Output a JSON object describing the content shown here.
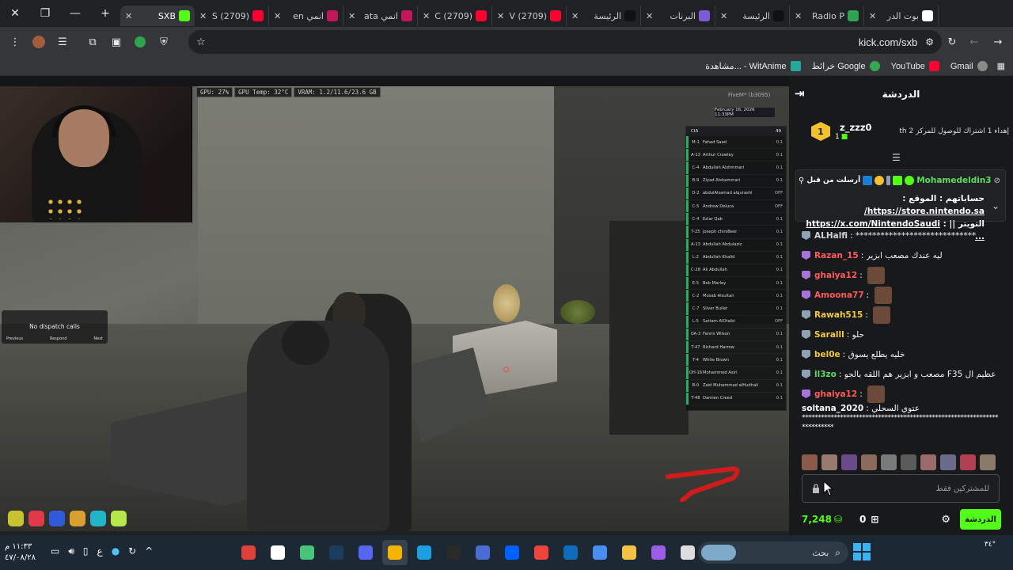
{
  "browser": {
    "window_controls": {
      "close": "✕",
      "restore": "❐",
      "minimize": "—"
    },
    "new_tab": "+",
    "tabs": [
      {
        "title": "بوت الدر",
        "color": "#ffffff",
        "active": false
      },
      {
        "title": "Radio P",
        "color": "#2ea44f",
        "active": false
      },
      {
        "title": "الرئيسة",
        "color": "#111111",
        "active": false
      },
      {
        "title": "البرنات",
        "color": "#7b5cd6",
        "active": false
      },
      {
        "title": "الرئيسة",
        "color": "#111111",
        "active": false
      },
      {
        "title": "(2709) V",
        "color": "#ff0033",
        "active": false
      },
      {
        "title": "(2709) C",
        "color": "#ff0033",
        "active": false
      },
      {
        "title": "انمي ata",
        "color": "#c2185b",
        "active": false
      },
      {
        "title": "انمي en",
        "color": "#c2185b",
        "active": false
      },
      {
        "title": "(2709) S",
        "color": "#ff0033",
        "active": false
      },
      {
        "title": "SXB",
        "color": "#53fc18",
        "active": true
      }
    ],
    "url": "kick.com/sxb",
    "bookmarks": [
      {
        "label": "Gmail",
        "color": "#ea4335"
      },
      {
        "label": "YouTube",
        "color": "#ff0033"
      },
      {
        "label": "خرائط Google",
        "color": "#34a853"
      },
      {
        "label": "مشاهدة... - WitAnime",
        "color": "#26a69a"
      }
    ]
  },
  "stream": {
    "gpu": [
      "GPU: 27%",
      "GPU Temp: 32°C",
      "VRAM: 1.2/11.6/23.6 GB"
    ],
    "watermark": "FiveM* (b3095)",
    "date": "February 16, 2026 11:33PM",
    "roster": {
      "title": "CIA",
      "count": "49",
      "members": [
        {
          "code": "M-1",
          "name": "Fahad Saad",
          "status": "0.1"
        },
        {
          "code": "A-13",
          "name": "Arthur Crowley",
          "status": "0.1"
        },
        {
          "code": "C-4",
          "name": "Abdullah Alshmmari",
          "status": "0.1"
        },
        {
          "code": "B-9",
          "name": "Ziyad Alshammari",
          "status": "0.1"
        },
        {
          "code": "D-2",
          "name": "abdulAlsamad alqurashi",
          "status": "OFF"
        },
        {
          "code": "C-5",
          "name": "Andrew Deluca",
          "status": "OFF"
        },
        {
          "code": "C-4",
          "name": "Ezlar Qab",
          "status": "0.1"
        },
        {
          "code": "T-25",
          "name": "Joseph chirsBeer",
          "status": "0.1"
        },
        {
          "code": "A-13",
          "name": "Abdullah Abdulaziz",
          "status": "0.1"
        },
        {
          "code": "L-2",
          "name": "Abdullah Khalid",
          "status": "0.1"
        },
        {
          "code": "C-28",
          "name": "Ali Abdullah",
          "status": "0.1"
        },
        {
          "code": "E-5",
          "name": "Bob Marley",
          "status": "0.1"
        },
        {
          "code": "C-2",
          "name": "Musab Alsultan",
          "status": "0.1"
        },
        {
          "code": "C-7",
          "name": "Silver Bullet",
          "status": "0.1"
        },
        {
          "code": "L-5",
          "name": "Sattam AlOtaibi",
          "status": "OFF"
        },
        {
          "code": "OA-3",
          "name": "Fenris Wilson",
          "status": "0.1"
        },
        {
          "code": "T-47",
          "name": "Richard Harrow",
          "status": "0.1"
        },
        {
          "code": "T-4",
          "name": "White Brown",
          "status": "0.1"
        },
        {
          "code": "OH-16",
          "name": "Mohammed Asiri",
          "status": "0.1"
        },
        {
          "code": "B-0",
          "name": "Zaid Muhammad alHudhali",
          "status": "0.1"
        },
        {
          "code": "T-48",
          "name": "Damien Creed",
          "status": "0.1"
        }
      ]
    },
    "dispatch": {
      "title": "No dispatch calls",
      "prev": "Previous",
      "respond": "Respond",
      "next": "Next"
    },
    "hud_colors": [
      "#c9c230",
      "#e03a4a",
      "#2f5bd8",
      "#d8a030",
      "#22b5c9",
      "#b6e84a"
    ]
  },
  "chat": {
    "title": "الدردشة",
    "gift": {
      "user": "z_zzz0",
      "badge": "1",
      "count": "1",
      "text": "إهداء 1 اشتراك للوصول للمركز 2 th"
    },
    "pinned": {
      "user": "Mohamedeldin3",
      "sent": "أرسلت من قبل",
      "line1_prefix": "حساباتهم : الموقع : ",
      "line1_link": "https://store.nintendo.sa/",
      "line2_prefix": "التويتر || : ",
      "line2_link": "https://x.com/NintendoSaudi ..."
    },
    "messages": [
      {
        "user": "ALHalfi",
        "color": "#d3d3d3",
        "badge": "gray",
        "text": "*****************************",
        "emote": false
      },
      {
        "user": "Razan_15",
        "color": "#ff5b5b",
        "badge": "purple",
        "text": "ليه عندك مصعب ابزير",
        "emote": false
      },
      {
        "user": "ghaiya12",
        "color": "#ff5b5b",
        "badge": "purple",
        "text": "",
        "emote": true
      },
      {
        "user": "Amoona77",
        "color": "#ff5b5b",
        "badge": "purple",
        "text": "",
        "emote": true
      },
      {
        "user": "Rawah515",
        "color": "#f1c93b",
        "badge": "gray",
        "text": "",
        "emote": true
      },
      {
        "user": "Saralll",
        "color": "#f1c93b",
        "badge": "gray",
        "text": "حلو",
        "emote": false
      },
      {
        "user": "bel0e",
        "color": "#f1c93b",
        "badge": "gray",
        "text": "خليه يطلع يسوق",
        "emote": false
      },
      {
        "user": "ll3zo",
        "color": "#5ddc5f",
        "badge": "gray",
        "text": "مصعب و ابزير هم اللقه بالجو F35 عظيم ال",
        "emote": false
      },
      {
        "user": "ghaiya12",
        "color": "#ff5b5b",
        "badge": "purple",
        "text": "",
        "emote": true
      }
    ],
    "last_message": {
      "user": "soltana_2020",
      "text": "عتوي السحلي",
      "stars": "************************************************************************"
    },
    "input_placeholder": "للمشتركين فقط",
    "viewers": "7,248",
    "points": "0",
    "chat_button": "الدردشة"
  },
  "taskbar": {
    "time": "١١:٣٣ م",
    "date": "٤٧/٠٨/٢٨",
    "language": "ع",
    "search_placeholder": "بحث",
    "weather": "٣٤°",
    "apps": [
      {
        "name": "adobe-acrobat",
        "color": "#e0403a"
      },
      {
        "name": "obs",
        "color": "#ffffff"
      },
      {
        "name": "roblox",
        "color": "#47c47c"
      },
      {
        "name": "steam",
        "color": "#1b3c5f"
      },
      {
        "name": "discord",
        "color": "#5865f2"
      },
      {
        "name": "chrome",
        "color": "#f4b400"
      },
      {
        "name": "edge",
        "color": "#1ba1e2"
      },
      {
        "name": "epic-games",
        "color": "#2a2a2a"
      },
      {
        "name": "app-generic",
        "color": "#4a6cd4"
      },
      {
        "name": "dropbox",
        "color": "#0061fe"
      },
      {
        "name": "anydesk",
        "color": "#ef443b"
      },
      {
        "name": "mail",
        "color": "#0f6cbd"
      },
      {
        "name": "store",
        "color": "#4a8df0"
      },
      {
        "name": "explorer",
        "color": "#f3c244"
      },
      {
        "name": "copilot",
        "color": "#9b5de5"
      },
      {
        "name": "files",
        "color": "#dddddd"
      }
    ]
  }
}
